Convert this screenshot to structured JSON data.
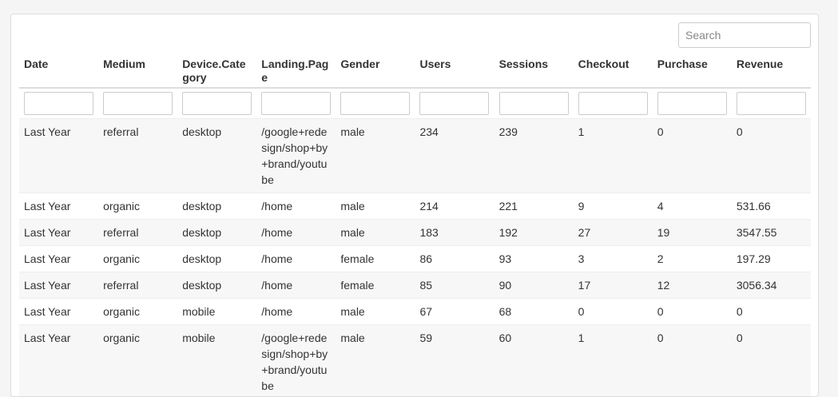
{
  "search": {
    "placeholder": "Search"
  },
  "columns": [
    "Date",
    "Medium",
    "Device.Category",
    "Landing.Page",
    "Gender",
    "Users",
    "Sessions",
    "Checkout",
    "Purchase",
    "Revenue"
  ],
  "rows": [
    [
      "Last Year",
      "referral",
      "desktop",
      "/google+redesign/shop+by+brand/youtube",
      "male",
      "234",
      "239",
      "1",
      "0",
      "0"
    ],
    [
      "Last Year",
      "organic",
      "desktop",
      "/home",
      "male",
      "214",
      "221",
      "9",
      "4",
      "531.66"
    ],
    [
      "Last Year",
      "referral",
      "desktop",
      "/home",
      "male",
      "183",
      "192",
      "27",
      "19",
      "3547.55"
    ],
    [
      "Last Year",
      "organic",
      "desktop",
      "/home",
      "female",
      "86",
      "93",
      "3",
      "2",
      "197.29"
    ],
    [
      "Last Year",
      "referral",
      "desktop",
      "/home",
      "female",
      "85",
      "90",
      "17",
      "12",
      "3056.34"
    ],
    [
      "Last Year",
      "organic",
      "mobile",
      "/home",
      "male",
      "67",
      "68",
      "0",
      "0",
      "0"
    ],
    [
      "Last Year",
      "organic",
      "mobile",
      "/google+redesign/shop+by+brand/youtube",
      "male",
      "59",
      "60",
      "1",
      "0",
      "0"
    ]
  ]
}
